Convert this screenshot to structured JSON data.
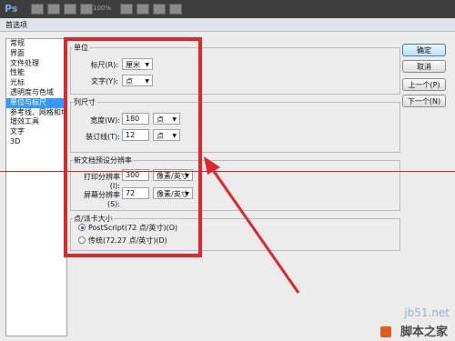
{
  "app": {
    "logo": "Ps",
    "zoom": "100%"
  },
  "dialog": {
    "title": "首选项"
  },
  "sidebar": {
    "items": [
      {
        "label": "常规"
      },
      {
        "label": "界面"
      },
      {
        "label": "文件处理"
      },
      {
        "label": "性能"
      },
      {
        "label": "光标"
      },
      {
        "label": "透明度与色域"
      },
      {
        "label": "单位与标尺",
        "selected": true
      },
      {
        "label": "参考线、网格和切片"
      },
      {
        "label": "增效工具"
      },
      {
        "label": "文字"
      },
      {
        "label": "3D"
      }
    ]
  },
  "units": {
    "group_label": "单位",
    "ruler_label": "标尺(R):",
    "ruler_value": "厘米",
    "type_label": "文字(Y):",
    "type_value": "点"
  },
  "column": {
    "group_label": "列尺寸",
    "width_label": "宽度(W):",
    "width_value": "180",
    "width_unit": "点",
    "gutter_label": "装订线(T):",
    "gutter_value": "12",
    "gutter_unit": "点"
  },
  "resolution": {
    "group_label": "新文档预设分辨率",
    "print_label": "打印分辨率(I):",
    "print_value": "300",
    "print_unit": "像素/英寸",
    "screen_label": "屏幕分辨率(S):",
    "screen_value": "72",
    "screen_unit": "像素/英寸"
  },
  "point_size": {
    "group_label": "点/派卡大小",
    "option1": "PostScript(72 点/英寸)(O)",
    "option2": "传统(72.27 点/英寸)(D)",
    "selected": "option1"
  },
  "buttons": {
    "ok": "确定",
    "cancel": "取消",
    "prev": "上一个(P)",
    "next": "下一个(N)"
  },
  "watermark": {
    "url": "jb51.net",
    "brand": "脚本之家"
  },
  "colors": {
    "highlight_red": "#e0262b",
    "selection_blue": "#3399ff"
  }
}
